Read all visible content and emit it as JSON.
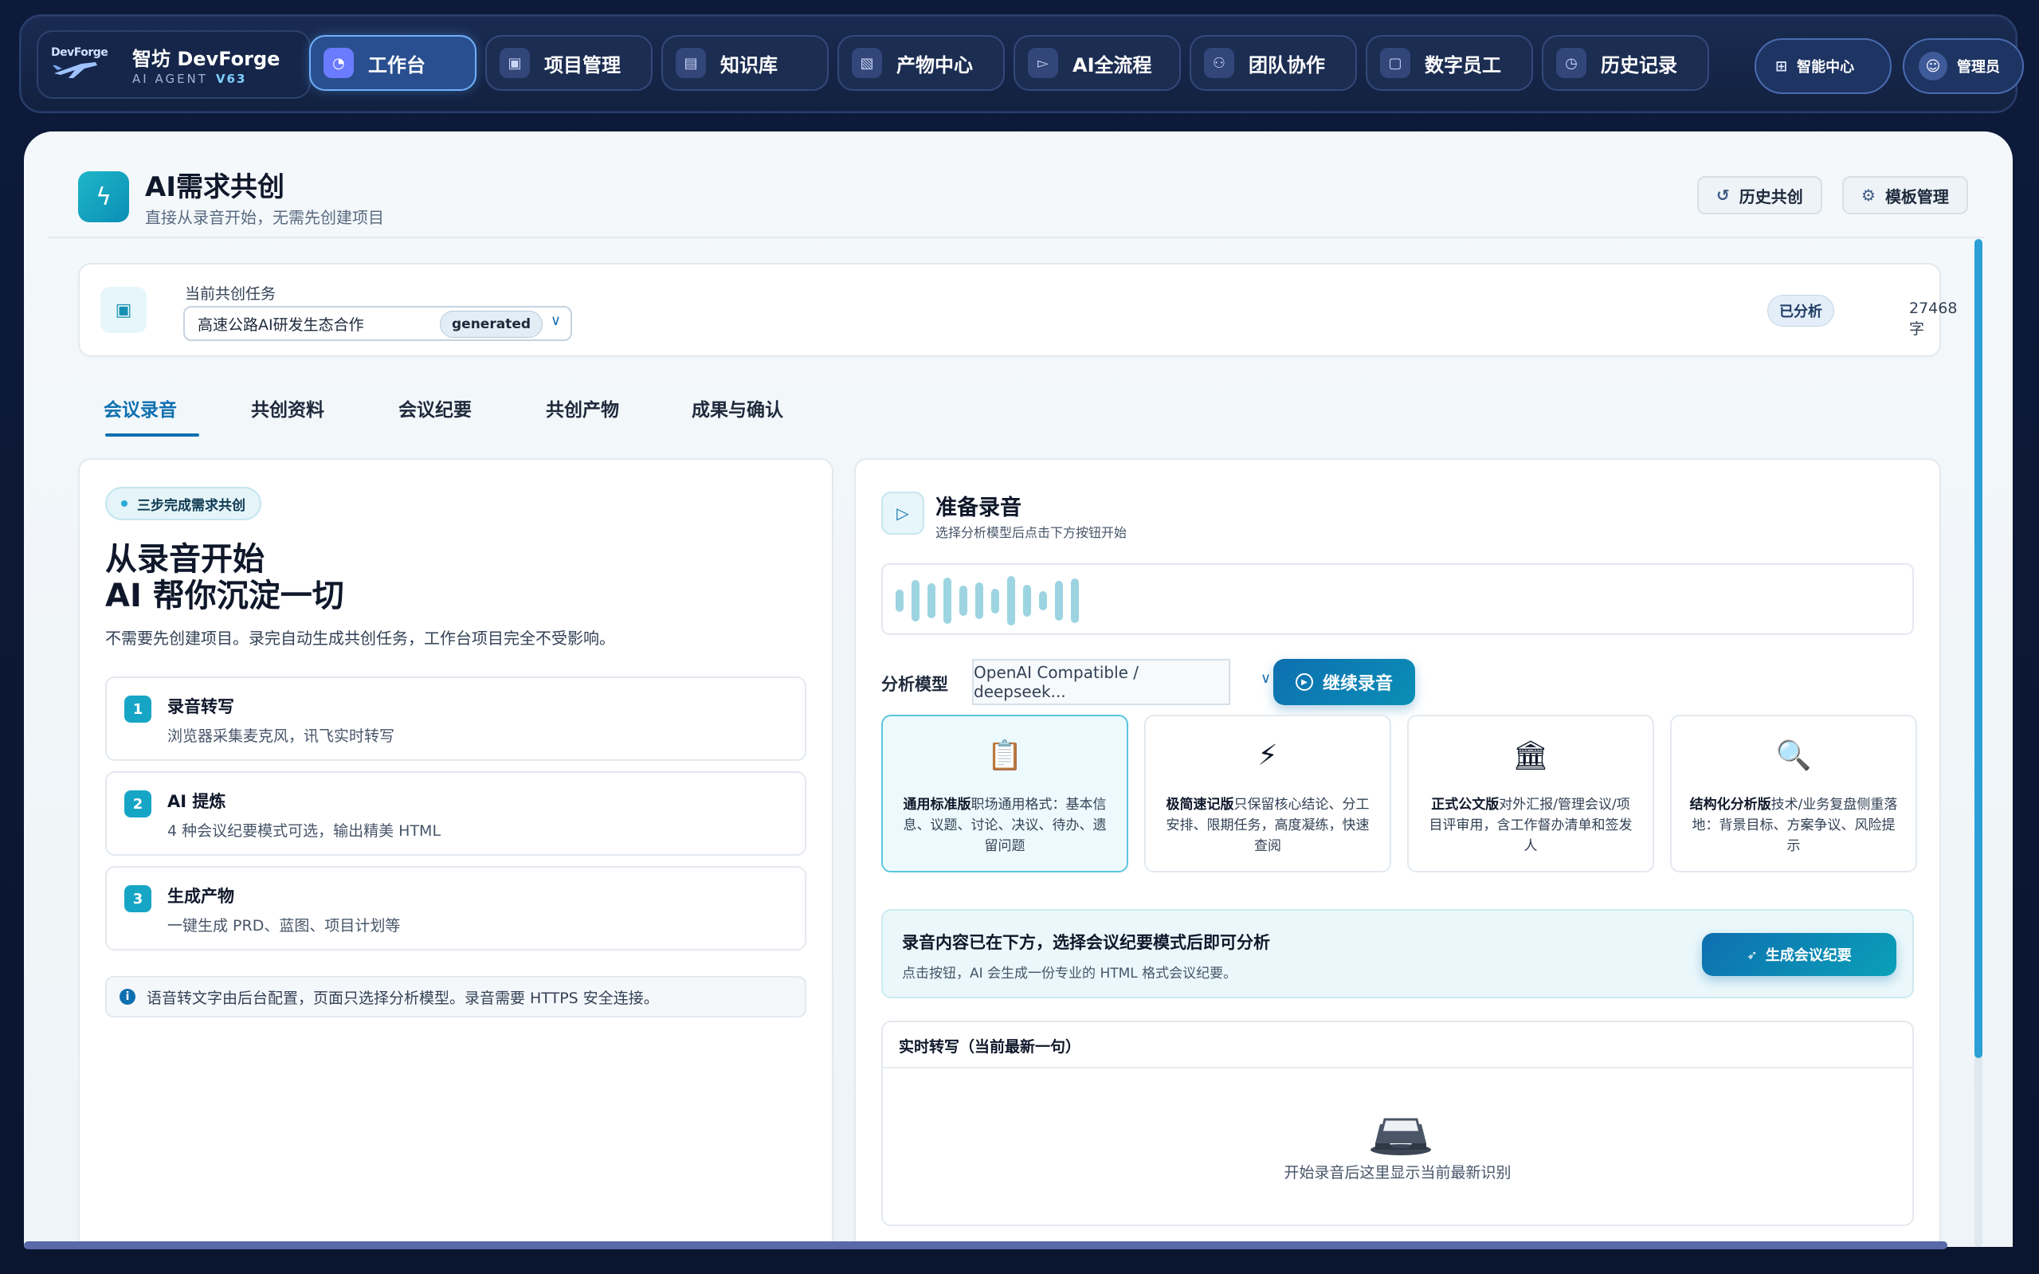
{
  "brand": {
    "logo_text": "DevForge",
    "title": "智坊 DevForge",
    "sub": "AI AGENT",
    "version": "V63"
  },
  "nav": {
    "items": [
      {
        "label": "工作台",
        "icon": "dashboard-icon",
        "active": true
      },
      {
        "label": "项目管理",
        "icon": "project-icon",
        "active": false
      },
      {
        "label": "知识库",
        "icon": "book-icon",
        "active": false
      },
      {
        "label": "产物中心",
        "icon": "document-icon",
        "active": false
      },
      {
        "label": "AI全流程",
        "icon": "terminal-icon",
        "active": false
      },
      {
        "label": "团队协作",
        "icon": "team-icon",
        "active": false
      },
      {
        "label": "数字员工",
        "icon": "robot-icon",
        "active": false
      },
      {
        "label": "历史记录",
        "icon": "clock-icon",
        "active": false
      }
    ],
    "smart_center": "智能中心",
    "admin": "管理员"
  },
  "header": {
    "title": "AI需求共创",
    "subtitle": "直接从录音开始，无需先创建项目",
    "history_btn": "历史共创",
    "template_btn": "模板管理"
  },
  "task": {
    "label": "当前共创任务",
    "value": "高速公路AI研发生态合作",
    "badge": "generated",
    "status": "已分析",
    "chars": "27468 字"
  },
  "tabs": [
    {
      "label": "会议录音",
      "active": true
    },
    {
      "label": "共创资料",
      "active": false
    },
    {
      "label": "会议纪要",
      "active": false
    },
    {
      "label": "共创产物",
      "active": false
    },
    {
      "label": "成果与确认",
      "active": false
    }
  ],
  "left": {
    "chip": "三步完成需求共创",
    "hero_line1": "从录音开始",
    "hero_line2": "AI 帮你沉淀一切",
    "desc": "不需要先创建项目。录完自动生成共创任务，工作台项目完全不受影响。",
    "steps": [
      {
        "num": "1",
        "title": "录音转写",
        "desc": "浏览器采集麦克风，讯飞实时转写"
      },
      {
        "num": "2",
        "title": "AI 提炼",
        "desc": "4 种会议纪要模式可选，输出精美 HTML"
      },
      {
        "num": "3",
        "title": "生成产物",
        "desc": "一键生成 PRD、蓝图、项目计划等"
      }
    ],
    "note": "语音转文字由后台配置，页面只选择分析模型。录音需要 HTTPS 安全连接。"
  },
  "right": {
    "title": "准备录音",
    "subtitle": "选择分析模型后点击下方按钮开始",
    "wave_levels": [
      0.45,
      0.85,
      0.7,
      0.95,
      0.6,
      0.75,
      0.5,
      1.0,
      0.65,
      0.4,
      0.8,
      0.9
    ],
    "model_label": "分析模型",
    "model_value": "OpenAI Compatible / deepseek...",
    "continue_btn": "继续录音",
    "modes": [
      {
        "icon": "clipboard-icon",
        "glyph": "📋",
        "title": "通用标准版",
        "desc": "职场通用格式：基本信息、议题、讨论、决议、待办、遗留问题",
        "selected": true
      },
      {
        "icon": "lightning-icon",
        "glyph": "⚡",
        "title": "极简速记版",
        "desc": "只保留核心结论、分工安排、限期任务，高度凝练，快速查阅",
        "selected": false
      },
      {
        "icon": "institution-icon",
        "glyph": "🏛",
        "title": "正式公文版",
        "desc": "对外汇报/管理会议/项目评审用，含工作督办清单和签发人",
        "selected": false
      },
      {
        "icon": "magnifier-icon",
        "glyph": "🔍",
        "title": "结构化分析版",
        "desc": "技术/业务复盘侧重落地：背景目标、方案争议、风险提示",
        "selected": false
      }
    ],
    "notice_title": "录音内容已在下方，选择会议纪要模式后即可分析",
    "notice_sub": "点击按钮，AI 会生成一份专业的 HTML 格式会议纪要。",
    "generate_btn": "生成会议纪要",
    "transcript_head": "实时转写（当前最新一句）",
    "transcript_empty": "开始录音后这里显示当前最新识别"
  }
}
